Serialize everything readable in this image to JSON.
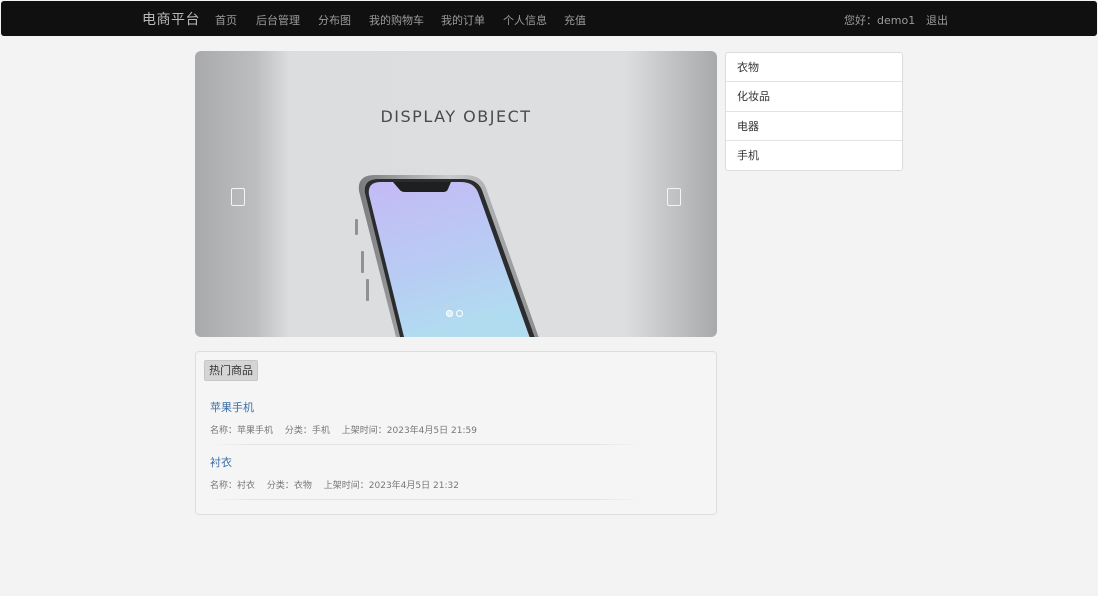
{
  "nav": {
    "brand": "电商平台",
    "links": [
      "首页",
      "后台管理",
      "分布图",
      "我的购物车",
      "我的订单",
      "个人信息",
      "充值"
    ],
    "greeting": "您好：demo1",
    "logout": "退出"
  },
  "carousel": {
    "slide_title": "DISPLAY OBJECT"
  },
  "categories": [
    "衣物",
    "化妆品",
    "电器",
    "手机"
  ],
  "hot": {
    "title": "热门商品",
    "products": [
      {
        "name": "苹果手机",
        "meta_name": "名称：苹果手机",
        "meta_category": "分类：手机",
        "meta_time": "上架时间：2023年4月5日 21:59"
      },
      {
        "name": "衬衣",
        "meta_name": "名称：衬衣",
        "meta_category": "分类：衣物",
        "meta_time": "上架时间：2023年4月5日 21:32"
      }
    ]
  }
}
